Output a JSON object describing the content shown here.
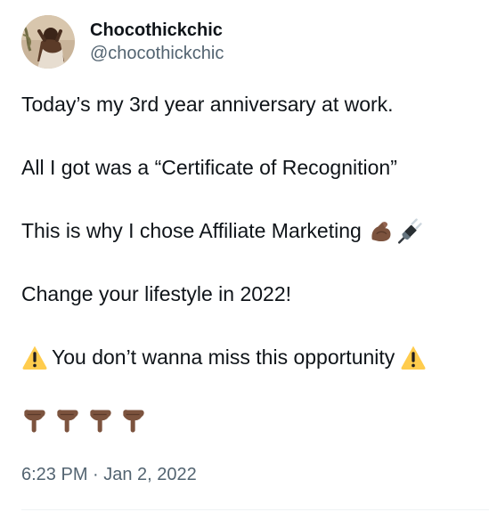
{
  "author": {
    "display_name": "Chocothickchic",
    "handle": "@chocothickchic"
  },
  "tweet": {
    "lines": [
      "Today’s my 3rd year anniversary at work.",
      "All I got was a “Certificate of Recognition”",
      "This is why I chose Affiliate Marketing",
      "Change your lifestyle in 2022!",
      "You don’t wanna miss this opportunity"
    ],
    "emojis": {
      "line3": [
        "flexed-biceps",
        "electric-plug"
      ],
      "line5": [
        "warning",
        "warning"
      ],
      "trailer": [
        "point-down",
        "point-down",
        "point-down",
        "point-down"
      ]
    },
    "timestamp": "6:23 PM · Jan 2, 2022"
  },
  "colors": {
    "text": "#0f1419",
    "secondary": "#536471",
    "divider": "#eff3f4",
    "warning_yellow": "#ffcc4d",
    "skin_dark": "#7c533e"
  }
}
